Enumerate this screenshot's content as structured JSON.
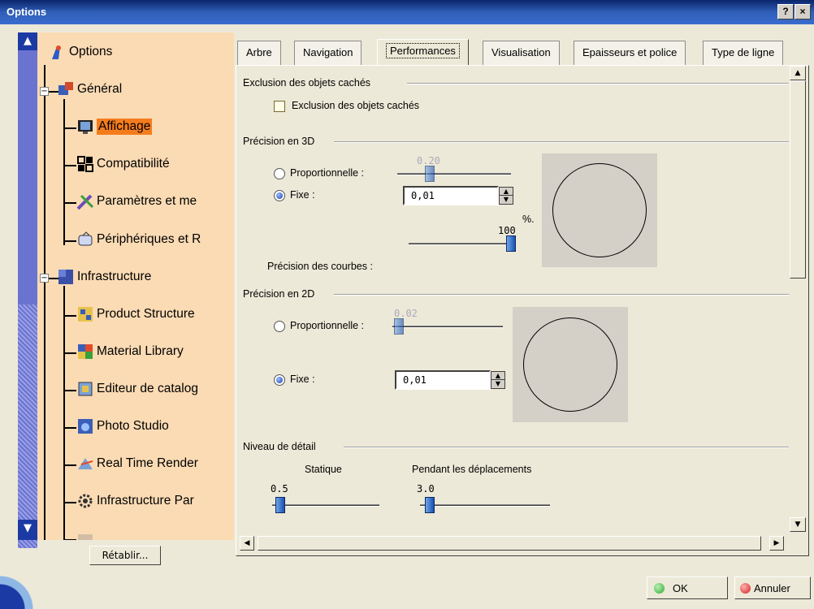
{
  "window": {
    "title": "Options",
    "help_label": "?",
    "close_label": "×"
  },
  "tree": {
    "items": [
      {
        "label": "Options",
        "icon": "options-icon"
      },
      {
        "label": "Général",
        "icon": "general-icon"
      },
      {
        "label": "Affichage",
        "icon": "display-icon",
        "selected": true
      },
      {
        "label": "Compatibilité",
        "icon": "compatibility-icon"
      },
      {
        "label": "Paramètres et me",
        "icon": "parameters-icon"
      },
      {
        "label": "Périphériques et R",
        "icon": "devices-icon"
      },
      {
        "label": "Infrastructure",
        "icon": "infrastructure-icon"
      },
      {
        "label": "Product Structure",
        "icon": "product-structure-icon"
      },
      {
        "label": "Material Library",
        "icon": "material-library-icon"
      },
      {
        "label": "Editeur de catalog",
        "icon": "catalog-editor-icon"
      },
      {
        "label": "Photo Studio",
        "icon": "photo-studio-icon"
      },
      {
        "label": "Real Time Render",
        "icon": "real-time-render-icon"
      },
      {
        "label": "Infrastructure Par",
        "icon": "gear-icon"
      }
    ],
    "reset_label": "Rétablir..."
  },
  "tabs": [
    {
      "label": "Arbre"
    },
    {
      "label": "Navigation"
    },
    {
      "label": "Performances",
      "active": true
    },
    {
      "label": "Visualisation"
    },
    {
      "label": "Epaisseurs et police"
    },
    {
      "label": "Type de ligne"
    }
  ],
  "performances": {
    "hidden_exclusion": {
      "group": "Exclusion des objets cachés",
      "checkbox_label": "Exclusion des objets cachés",
      "checked": false
    },
    "precision3d": {
      "group": "Précision en 3D",
      "proportional_label": "Proportionnelle :",
      "proportional_value": "0.20",
      "fixed_label": "Fixe :",
      "fixed_value": "0,01",
      "fixed_selected": true,
      "percent_label": "%.",
      "curve_value": "100",
      "curve_label": "Précision des courbes :"
    },
    "precision2d": {
      "group": "Précision en 2D",
      "proportional_label": "Proportionnelle :",
      "proportional_value": "0.02",
      "fixed_label": "Fixe :",
      "fixed_value": "0,01",
      "fixed_selected": true
    },
    "detail": {
      "group": "Niveau de détail",
      "static_label": "Statique",
      "static_value": "0.5",
      "moving_label": "Pendant les déplacements",
      "moving_value": "3.0"
    }
  },
  "buttons": {
    "ok": "OK",
    "cancel": "Annuler"
  },
  "colors": {
    "title_bar": "#0a246a",
    "selected_item": "#f57c1d",
    "tree_bg": "#fbdbb4",
    "ok_dot": "#2fa82f",
    "cancel_dot": "#d32020"
  }
}
